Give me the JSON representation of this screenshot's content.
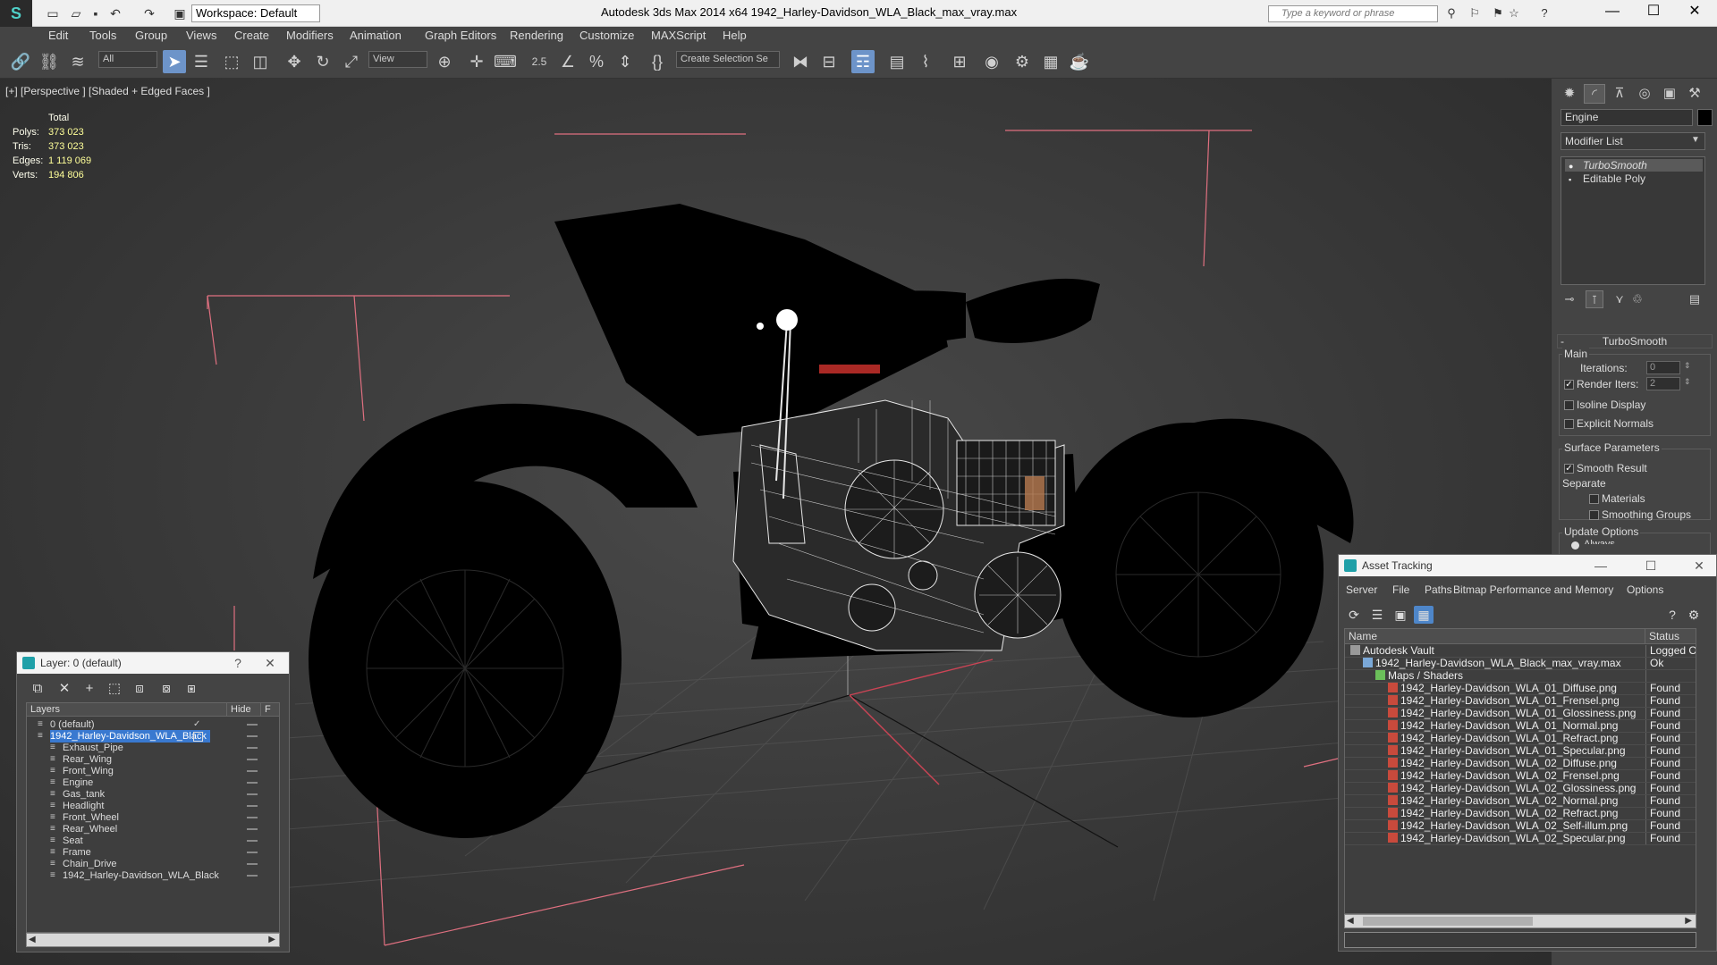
{
  "titlebar": {
    "workspace": "Workspace: Default",
    "window_title": "Autodesk 3ds Max 2014 x64       1942_Harley-Davidson_WLA_Black_max_vray.max",
    "search_placeholder": "Type a keyword or phrase"
  },
  "menu": [
    "Edit",
    "Tools",
    "Group",
    "Views",
    "Create",
    "Modifiers",
    "Animation",
    "Graph Editors",
    "Rendering",
    "Customize",
    "MAXScript",
    "Help"
  ],
  "toolbar": {
    "selection_filter": "All",
    "ref_coord": "View",
    "snap_value": "2.5",
    "named_selection": "Create Selection Se"
  },
  "viewport": {
    "label": "[+] [Perspective ] [Shaded + Edged Faces ]",
    "stats": {
      "header": "Total",
      "rows": [
        {
          "label": "Polys:",
          "value": "373 023"
        },
        {
          "label": "Tris:",
          "value": "373 023"
        },
        {
          "label": "Edges:",
          "value": "1 119 069"
        },
        {
          "label": "Verts:",
          "value": "194 806"
        }
      ]
    }
  },
  "command_panel": {
    "object_name": "Engine",
    "object_color": "#000000",
    "modifier_list": "Modifier List",
    "stack": [
      {
        "label": "TurboSmooth",
        "selected": true
      },
      {
        "label": "Editable Poly",
        "selected": false
      }
    ],
    "rollout_title": "TurboSmooth",
    "main_group": "Main",
    "iterations_label": "Iterations:",
    "iterations_value": "0",
    "render_iters_label": "Render Iters:",
    "render_iters_value": "2",
    "isoline_label": "Isoline Display",
    "explicit_normals_label": "Explicit Normals",
    "surface_group": "Surface Parameters",
    "smooth_result_label": "Smooth Result",
    "separate_label": "Separate",
    "materials_label": "Materials",
    "smoothing_groups_label": "Smoothing Groups",
    "update_group": "Update Options",
    "always_label": "Always"
  },
  "layer_panel": {
    "title": "Layer: 0 (default)",
    "help": "?",
    "col_layers": "Layers",
    "col_hide": "Hide",
    "col_f": "F",
    "rows": [
      {
        "name": "0 (default)",
        "indent": 1,
        "selected": false,
        "check": true
      },
      {
        "name": "1942_Harley-Davidson_WLA_Black",
        "indent": 1,
        "selected": true,
        "check": false
      },
      {
        "name": "Exhaust_Pipe",
        "indent": 2,
        "selected": false,
        "check": false
      },
      {
        "name": "Rear_Wing",
        "indent": 2,
        "selected": false,
        "check": false
      },
      {
        "name": "Front_Wing",
        "indent": 2,
        "selected": false,
        "check": false
      },
      {
        "name": "Engine",
        "indent": 2,
        "selected": false,
        "check": false
      },
      {
        "name": "Gas_tank",
        "indent": 2,
        "selected": false,
        "check": false
      },
      {
        "name": "Headlight",
        "indent": 2,
        "selected": false,
        "check": false
      },
      {
        "name": "Front_Wheel",
        "indent": 2,
        "selected": false,
        "check": false
      },
      {
        "name": "Rear_Wheel",
        "indent": 2,
        "selected": false,
        "check": false
      },
      {
        "name": "Seat",
        "indent": 2,
        "selected": false,
        "check": false
      },
      {
        "name": "Frame",
        "indent": 2,
        "selected": false,
        "check": false
      },
      {
        "name": "Chain_Drive",
        "indent": 2,
        "selected": false,
        "check": false
      },
      {
        "name": "1942_Harley-Davidson_WLA_Black",
        "indent": 2,
        "selected": false,
        "check": false
      }
    ]
  },
  "asset_panel": {
    "title": "Asset Tracking",
    "menu": [
      "Server",
      "File",
      "Paths",
      "Bitmap Performance and Memory",
      "Options"
    ],
    "col_name": "Name",
    "col_status": "Status",
    "rows": [
      {
        "name": "Autodesk Vault",
        "status": "Logged O",
        "indent": 1,
        "kind": "vault"
      },
      {
        "name": "1942_Harley-Davidson_WLA_Black_max_vray.max",
        "status": "Ok",
        "indent": 2,
        "kind": "max"
      },
      {
        "name": "Maps / Shaders",
        "status": "",
        "indent": 3,
        "kind": "folder"
      },
      {
        "name": "1942_Harley-Davidson_WLA_01_Diffuse.png",
        "status": "Found",
        "indent": 4,
        "kind": "png"
      },
      {
        "name": "1942_Harley-Davidson_WLA_01_Frensel.png",
        "status": "Found",
        "indent": 4,
        "kind": "png"
      },
      {
        "name": "1942_Harley-Davidson_WLA_01_Glossiness.png",
        "status": "Found",
        "indent": 4,
        "kind": "png"
      },
      {
        "name": "1942_Harley-Davidson_WLA_01_Normal.png",
        "status": "Found",
        "indent": 4,
        "kind": "png"
      },
      {
        "name": "1942_Harley-Davidson_WLA_01_Refract.png",
        "status": "Found",
        "indent": 4,
        "kind": "png"
      },
      {
        "name": "1942_Harley-Davidson_WLA_01_Specular.png",
        "status": "Found",
        "indent": 4,
        "kind": "png"
      },
      {
        "name": "1942_Harley-Davidson_WLA_02_Diffuse.png",
        "status": "Found",
        "indent": 4,
        "kind": "png"
      },
      {
        "name": "1942_Harley-Davidson_WLA_02_Frensel.png",
        "status": "Found",
        "indent": 4,
        "kind": "png"
      },
      {
        "name": "1942_Harley-Davidson_WLA_02_Glossiness.png",
        "status": "Found",
        "indent": 4,
        "kind": "png"
      },
      {
        "name": "1942_Harley-Davidson_WLA_02_Normal.png",
        "status": "Found",
        "indent": 4,
        "kind": "png"
      },
      {
        "name": "1942_Harley-Davidson_WLA_02_Refract.png",
        "status": "Found",
        "indent": 4,
        "kind": "png"
      },
      {
        "name": "1942_Harley-Davidson_WLA_02_Self-illum.png",
        "status": "Found",
        "indent": 4,
        "kind": "png"
      },
      {
        "name": "1942_Harley-Davidson_WLA_02_Specular.png",
        "status": "Found",
        "indent": 4,
        "kind": "png"
      }
    ]
  },
  "colors": {
    "accent": "#3979d0",
    "selection_bracket": "#e07080",
    "stats_value": "#ffff99"
  }
}
